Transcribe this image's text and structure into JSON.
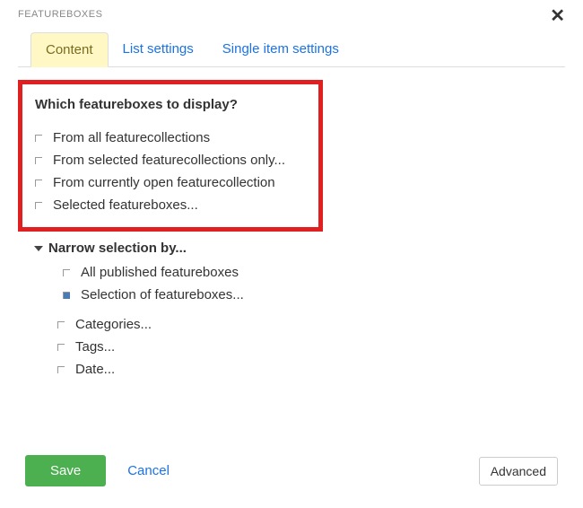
{
  "dialog": {
    "title": "FEATUREBOXES"
  },
  "tabs": {
    "content": "Content",
    "list_settings": "List settings",
    "single_item": "Single item settings"
  },
  "content": {
    "heading": "Which featureboxes to display?",
    "options": [
      "From all featurecollections",
      "From selected featurecollections only...",
      "From currently open featurecollection",
      "Selected featureboxes..."
    ],
    "narrow": {
      "heading": "Narrow selection by...",
      "primary": [
        "All published featureboxes",
        "Selection of featureboxes..."
      ],
      "secondary": [
        "Categories...",
        "Tags...",
        "Date..."
      ]
    }
  },
  "footer": {
    "save": "Save",
    "cancel": "Cancel",
    "advanced": "Advanced"
  }
}
